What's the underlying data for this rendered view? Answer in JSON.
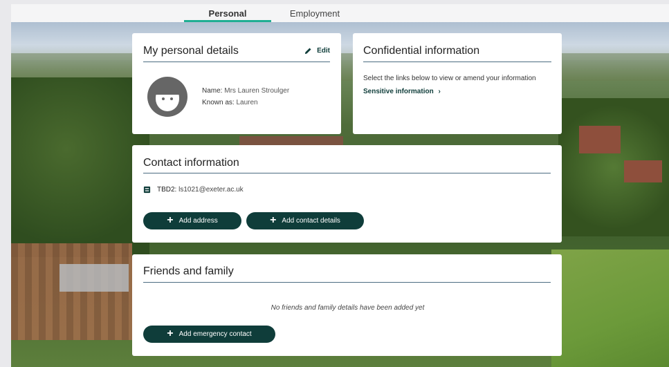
{
  "tabs": [
    {
      "label": "Personal",
      "active": true
    },
    {
      "label": "Employment",
      "active": false
    }
  ],
  "accent_color": "#1fae93",
  "button_color": "#0f3d3a",
  "personal_details": {
    "title": "My personal details",
    "edit_label": "Edit",
    "name_label": "Name:",
    "name_value": "Mrs Lauren Stroulger",
    "known_as_label": "Known as:",
    "known_as_value": "Lauren"
  },
  "confidential": {
    "title": "Confidential information",
    "description": "Select the links below to view or amend your information",
    "link_label": "Sensitive information"
  },
  "contact": {
    "title": "Contact information",
    "entry_label": "TBD2:",
    "entry_value": "ls1021@exeter.ac.uk",
    "add_address_label": "Add address",
    "add_contact_label": "Add contact details"
  },
  "friends": {
    "title": "Friends and family",
    "empty_message": "No friends and family details have been added yet",
    "add_emergency_label": "Add emergency contact"
  }
}
